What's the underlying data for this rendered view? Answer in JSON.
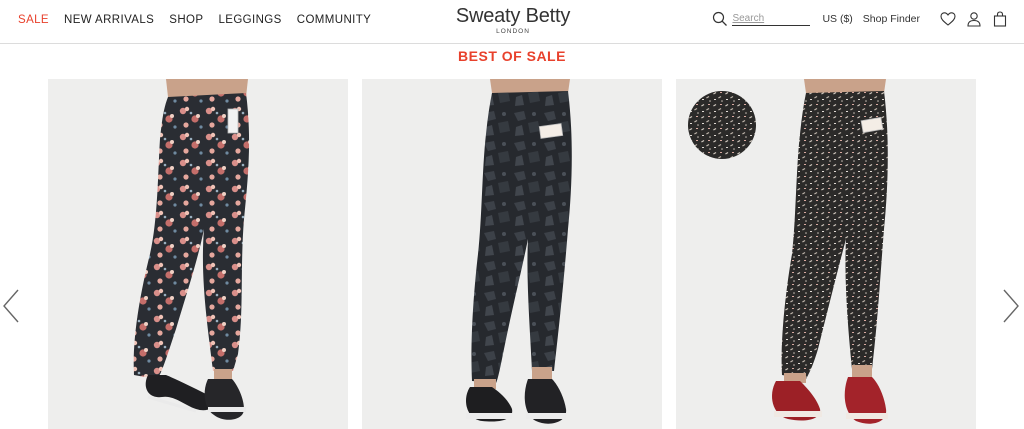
{
  "header": {
    "nav": [
      {
        "label": "SALE",
        "name": "nav-sale"
      },
      {
        "label": "NEW ARRIVALS",
        "name": "nav-new-arrivals"
      },
      {
        "label": "SHOP",
        "name": "nav-shop"
      },
      {
        "label": "LEGGINGS",
        "name": "nav-leggings"
      },
      {
        "label": "COMMUNITY",
        "name": "nav-community"
      }
    ],
    "logo": {
      "brand": "Sweaty Betty",
      "sub": "LONDON"
    },
    "search": {
      "placeholder": "Search"
    },
    "currency": "US ($)",
    "shop_finder": "Shop Finder"
  },
  "section": {
    "title": "BEST OF SALE"
  },
  "colors": {
    "accent": "#e8412c",
    "card_bg": "#eeeeed"
  },
  "icons": [
    "search-icon",
    "heart-icon",
    "user-icon",
    "bag-icon",
    "chevron-left-icon",
    "chevron-right-icon"
  ],
  "products": [
    {
      "name": "floral-print-leggings"
    },
    {
      "name": "dark-camo-print-leggings"
    },
    {
      "name": "speckle-print-leggings"
    }
  ]
}
